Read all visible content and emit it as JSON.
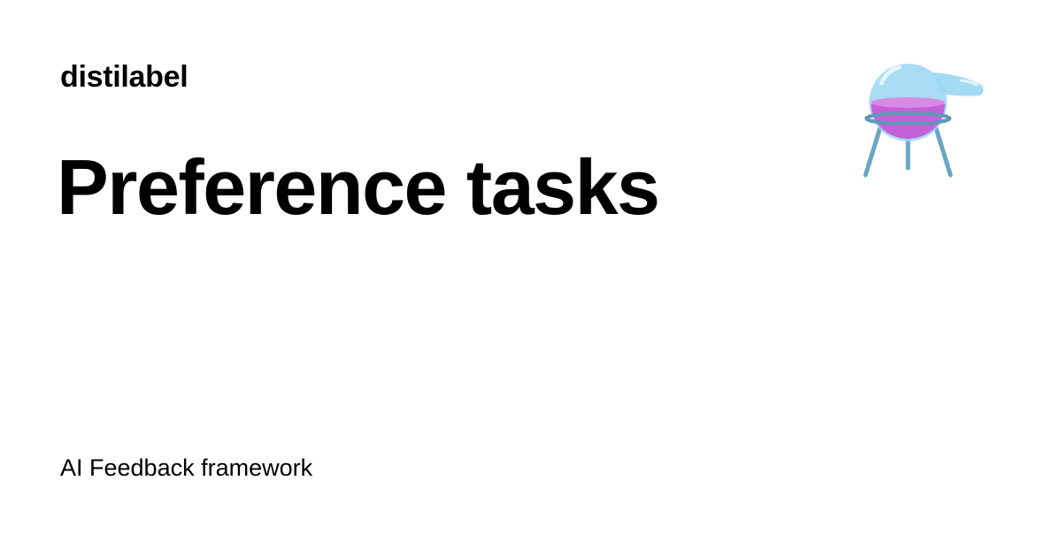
{
  "site": {
    "name": "distilabel"
  },
  "page": {
    "title": "Preference tasks",
    "description": "AI Feedback framework"
  },
  "logo": {
    "icon": "flask-on-stand-icon",
    "colors": {
      "glass": "#9ad7f3",
      "liquid": "#c561d8",
      "stand": "#6aa6c4"
    }
  }
}
